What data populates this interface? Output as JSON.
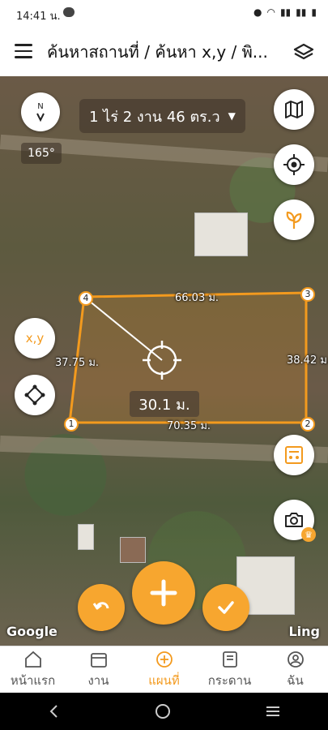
{
  "status_bar": {
    "time": "14:41 น."
  },
  "header": {
    "title": "ค้นหาสถานที่ / ค้นหา x,y / พิ..."
  },
  "map": {
    "area_text": "1 ไร่ 2 งาน 46 ตร.ว",
    "heading": "165°",
    "compass_label": "N",
    "xy_label": "x,y",
    "distance_readout": "30.1 ม.",
    "edges": {
      "top": "66.03 ม.",
      "left": "37.75 ม.",
      "right": "38.42 ม.",
      "bottom": "70.35 ม."
    },
    "vertices": [
      "1",
      "2",
      "3",
      "4"
    ],
    "google_label": "Google",
    "ling_label": "Ling"
  },
  "nav": {
    "items": [
      {
        "label": "หน้าแรก",
        "icon": "home-icon"
      },
      {
        "label": "งาน",
        "icon": "calendar-icon"
      },
      {
        "label": "แผนที่",
        "icon": "plus-circle-icon",
        "active": true
      },
      {
        "label": "กระดาน",
        "icon": "board-icon"
      },
      {
        "label": "ฉัน",
        "icon": "user-icon"
      }
    ]
  },
  "colors": {
    "accent": "#f7a62f",
    "polygon": "#f39a1e"
  }
}
